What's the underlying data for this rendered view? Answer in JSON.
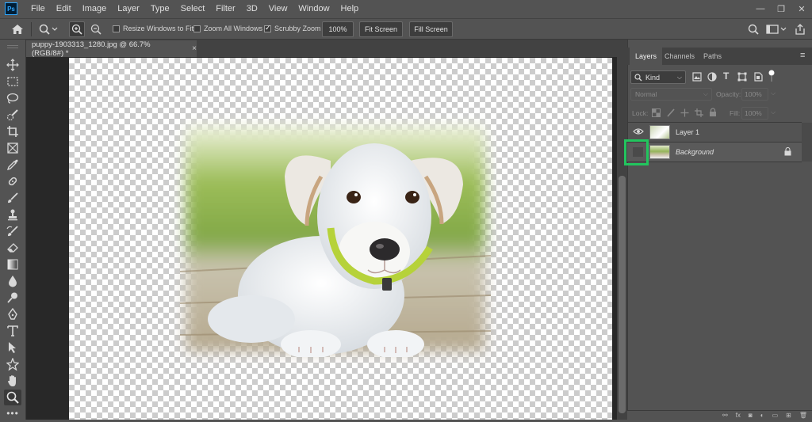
{
  "app": {
    "logo": "Ps"
  },
  "menu": [
    "File",
    "Edit",
    "Image",
    "Layer",
    "Type",
    "Select",
    "Filter",
    "3D",
    "View",
    "Window",
    "Help"
  ],
  "window_controls": {
    "minimize": "—",
    "restore": "❐",
    "close": "✕"
  },
  "options_bar": {
    "resize_windows_label": "Resize Windows to Fit",
    "zoom_all_label": "Zoom All Windows",
    "scrubby_zoom_label": "Scrubby Zoom",
    "zoom_value": "100%",
    "fit_screen_label": "Fit Screen",
    "fill_screen_label": "Fill Screen",
    "resize_windows_checked": false,
    "zoom_all_checked": false,
    "scrubby_zoom_checked": true
  },
  "document": {
    "tab_title": "puppy-1903313_1280.jpg @ 66.7% (RGB/8#) *",
    "close": "×"
  },
  "panels": {
    "tabs": [
      "Layers",
      "Channels",
      "Paths"
    ],
    "active_tab": "Layers",
    "filter_kind": "Kind",
    "blend_mode": "Normal",
    "opacity_label": "Opacity:",
    "opacity_value": "100%",
    "lock_label": "Lock:",
    "fill_label": "Fill:",
    "fill_value": "100%",
    "layers": [
      {
        "name": "Layer 1",
        "visible": true,
        "italic": false
      },
      {
        "name": "Background",
        "visible": false,
        "italic": true,
        "locked": true
      }
    ]
  },
  "highlight_color": "#22c55e"
}
